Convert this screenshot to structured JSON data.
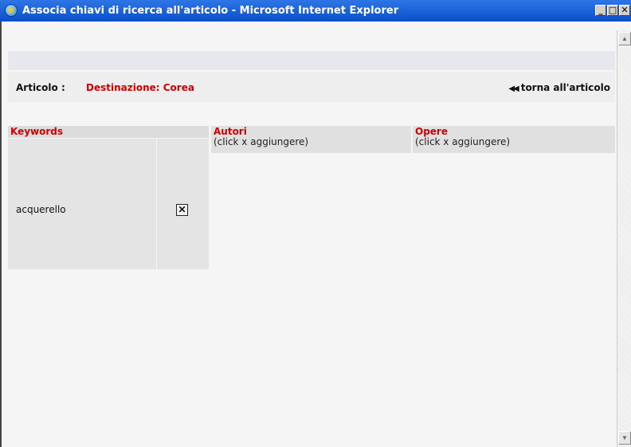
{
  "window": {
    "title": "Associa chiavi di ricerca all'articolo - Microsoft Internet Explorer",
    "minimize": "_",
    "maximize": "□",
    "close": "✕"
  },
  "article": {
    "label": "Articolo :",
    "value": "Destinazione: Corea",
    "back_link": "torna all'articolo"
  },
  "keywords": {
    "header": "Keywords",
    "items": [
      {
        "text": "acquerello",
        "delete_symbol": "✕"
      }
    ]
  },
  "columns": {
    "autori": {
      "header": "Autori",
      "subheader": "(click x aggiungere)"
    },
    "opere": {
      "header": "Opere",
      "subheader": "(click x aggiungere)"
    }
  },
  "colors": {
    "accent_red": "#cc0000",
    "titlebar_blue": "#0a4fc8"
  }
}
